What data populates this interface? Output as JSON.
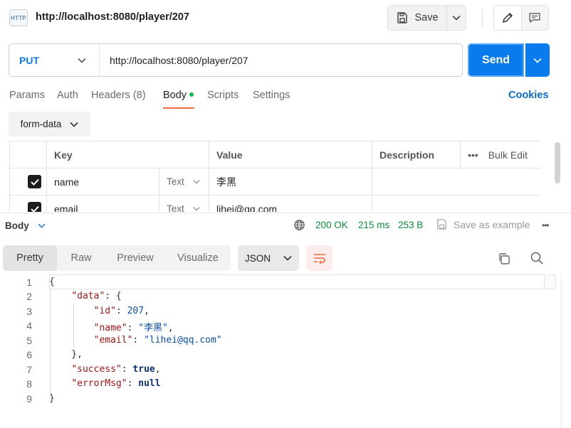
{
  "header": {
    "badge": "HTTP",
    "title": "http://localhost:8080/player/207",
    "save_label": "Save"
  },
  "request": {
    "method": "PUT",
    "url": "http://localhost:8080/player/207",
    "send_label": "Send"
  },
  "tabs": {
    "items": [
      {
        "label": "Params"
      },
      {
        "label": "Auth"
      },
      {
        "label": "Headers (8)"
      },
      {
        "label": "Body",
        "active": true,
        "indicator_color": "#0cbb52"
      },
      {
        "label": "Scripts"
      },
      {
        "label": "Settings"
      }
    ],
    "cookies_label": "Cookies"
  },
  "body_type": "form-data",
  "params_table": {
    "headers": [
      "Key",
      "Value",
      "Description"
    ],
    "bulk_edit": "Bulk Edit",
    "rows": [
      {
        "checked": true,
        "key": "name",
        "type": "Text",
        "value": "李黑",
        "description": ""
      },
      {
        "checked": true,
        "key": "email",
        "type": "Text",
        "value": "lihei@qq.com",
        "description": ""
      }
    ]
  },
  "response": {
    "section_label": "Body",
    "status": "200 OK",
    "time": "215 ms",
    "size": "253 B",
    "save_example_label": "Save as example",
    "view_tabs": [
      "Pretty",
      "Raw",
      "Preview",
      "Visualize"
    ],
    "active_view": "Pretty",
    "format": "JSON",
    "code_lines": [
      "1",
      "2",
      "3",
      "4",
      "5",
      "6",
      "7",
      "8",
      "9"
    ],
    "json": {
      "data_key": "\"data\"",
      "id_key": "\"id\"",
      "id_value": "207",
      "name_key": "\"name\"",
      "name_value": "\"李黑\"",
      "email_key": "\"email\"",
      "email_value": "\"lihei@qq.com\"",
      "success_key": "\"success\"",
      "success_value": "true",
      "error_key": "\"errorMsg\"",
      "error_value": "null"
    }
  },
  "colors": {
    "accent": "#097bed",
    "method": "#097bed",
    "status_ok": "#0a8c3c",
    "tab_underline": "#f26b3a"
  }
}
